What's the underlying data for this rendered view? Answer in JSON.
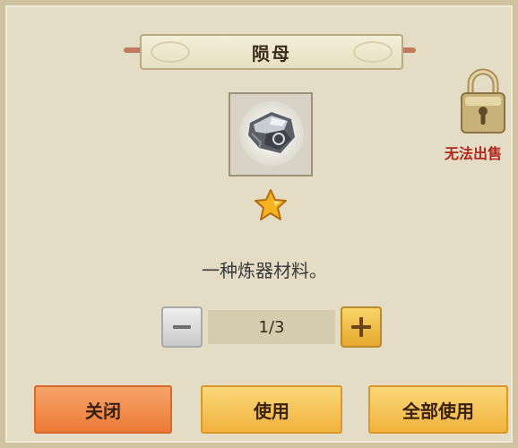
{
  "dialog": {
    "title": "陨母",
    "description": "一种炼器材料。",
    "sell_status": "无法出售",
    "rarity_stars": 1
  },
  "item": {
    "icon": "ore-chunk-icon"
  },
  "quantity": {
    "display": "1/3",
    "current": 1,
    "max": 3,
    "decrement_icon": "minus-icon",
    "increment_icon": "plus-icon"
  },
  "actions": {
    "close_label": "关闭",
    "use_label": "使用",
    "use_all_label": "全部使用"
  },
  "colors": {
    "panel_bg": "#e4dcc4",
    "sell_status": "#b0281e",
    "close_button": "#ec7a36",
    "use_button": "#f1b33e",
    "star": "#f5b21e"
  }
}
